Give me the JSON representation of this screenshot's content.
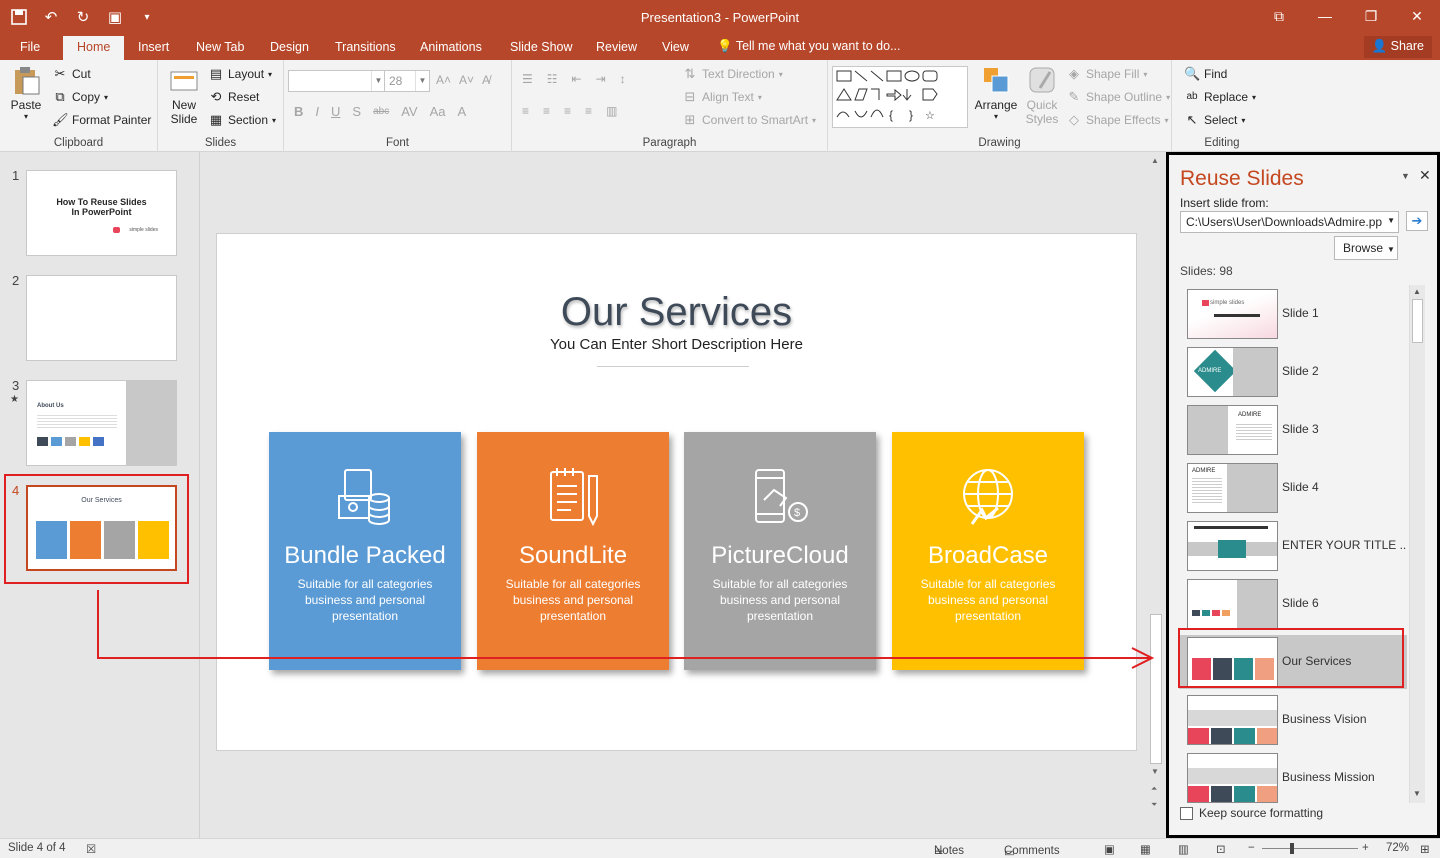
{
  "window": {
    "title": "Presentation3  -  PowerPoint"
  },
  "tabs": [
    "File",
    "Home",
    "Insert",
    "New Tab",
    "Design",
    "Transitions",
    "Animations",
    "Slide Show",
    "Review",
    "View"
  ],
  "tell_me": "Tell me what you want to do...",
  "share": "Share",
  "ribbon": {
    "clipboard": {
      "paste": "Paste",
      "cut": "Cut",
      "copy": "Copy",
      "format_painter": "Format Painter",
      "label": "Clipboard"
    },
    "slides": {
      "new_slide_1": "New",
      "new_slide_2": "Slide",
      "layout": "Layout",
      "reset": "Reset",
      "section": "Section",
      "label": "Slides"
    },
    "font": {
      "size": "28",
      "label": "Font"
    },
    "paragraph": {
      "text_direction": "Text Direction",
      "align_text": "Align Text",
      "convert_smartart": "Convert to SmartArt",
      "label": "Paragraph"
    },
    "drawing": {
      "arrange": "Arrange",
      "quick_styles_1": "Quick",
      "quick_styles_2": "Styles",
      "shape_fill": "Shape Fill",
      "shape_outline": "Shape Outline",
      "shape_effects": "Shape Effects",
      "label": "Drawing"
    },
    "editing": {
      "find": "Find",
      "replace": "Replace",
      "select": "Select",
      "label": "Editing"
    }
  },
  "thumbs": [
    {
      "num": "1",
      "t1": "How To Reuse Slides",
      "t2": "In PowerPoint",
      "brand": "simple slides"
    },
    {
      "num": "2"
    },
    {
      "num": "3",
      "star": "★",
      "heading": "About Us"
    },
    {
      "num": "4",
      "heading": "Our Services"
    }
  ],
  "slide": {
    "title": "Our Services",
    "description": "You Can Enter Short Description Here",
    "cards": [
      {
        "title": "Bundle Packed",
        "l1": "Suitable for all categories",
        "l2": "business and personal",
        "l3": "presentation",
        "color": "#5b9bd5"
      },
      {
        "title": "SoundLite",
        "l1": "Suitable for all categories",
        "l2": "business and personal",
        "l3": "presentation",
        "color": "#ed7d31"
      },
      {
        "title": "PictureCloud",
        "l1": "Suitable for all categories",
        "l2": "business and personal",
        "l3": "presentation",
        "color": "#a5a5a5"
      },
      {
        "title": "BroadCase",
        "l1": "Suitable for all categories",
        "l2": "business and personal",
        "l3": "presentation",
        "color": "#ffc000"
      }
    ]
  },
  "reuse": {
    "title": "Reuse Slides",
    "insert_from": "Insert slide from:",
    "path": "C:\\Users\\User\\Downloads\\Admire.pp",
    "browse": "Browse",
    "count": "Slides: 98",
    "items": [
      "Slide 1",
      "Slide 2",
      "Slide 3",
      "Slide 4",
      "ENTER YOUR TITLE ...",
      "Slide 6",
      "Our Services",
      "Business Vision",
      "Business Mission"
    ],
    "thumb_text": {
      "brand": "simple slides",
      "admire": "ADMIRE"
    },
    "keep_formatting": "Keep source formatting"
  },
  "status": {
    "slide_of": "Slide 4 of 4",
    "notes": "Notes",
    "comments": "Comments",
    "zoom": "72%"
  }
}
